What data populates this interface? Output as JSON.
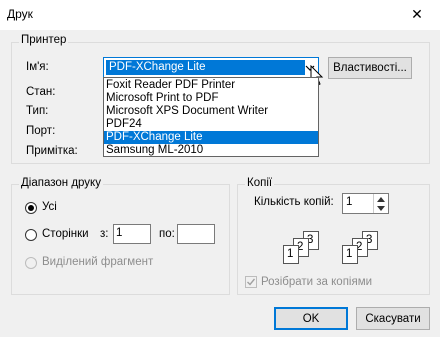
{
  "window": {
    "title": "Друк",
    "close_glyph": "✕"
  },
  "printer": {
    "group_label": "Принтер",
    "name_label": "Ім'я:",
    "selected": "PDF-XChange Lite",
    "properties_button": "Властивості...",
    "status_label": "Стан:",
    "type_label": "Тип:",
    "port_label": "Порт:",
    "comment_label": "Примітка:",
    "options": [
      "Foxit Reader PDF Printer",
      "Microsoft Print to PDF",
      "Microsoft XPS Document Writer",
      "PDF24",
      "PDF-XChange Lite",
      "Samsung ML-2010"
    ],
    "selected_index": 4
  },
  "range": {
    "group_label": "Діапазон друку",
    "all_label": "Усі",
    "pages_label": "Сторінки",
    "from_label": "з:",
    "from_value": "1",
    "to_label": "по:",
    "to_value": "",
    "selection_label": "Виділений фрагмент",
    "selected": "all"
  },
  "copies": {
    "group_label": "Копії",
    "count_label": "Кількість копій:",
    "count_value": "1",
    "collate_label": "Розібрати за копіями",
    "collate_checked": true,
    "collate_enabled": false,
    "page_numbers": [
      "1",
      "2",
      "3"
    ]
  },
  "buttons": {
    "ok": "OK",
    "cancel": "Скасувати"
  },
  "colors": {
    "accent": "#0078d7",
    "background": "#f0f0f0"
  }
}
